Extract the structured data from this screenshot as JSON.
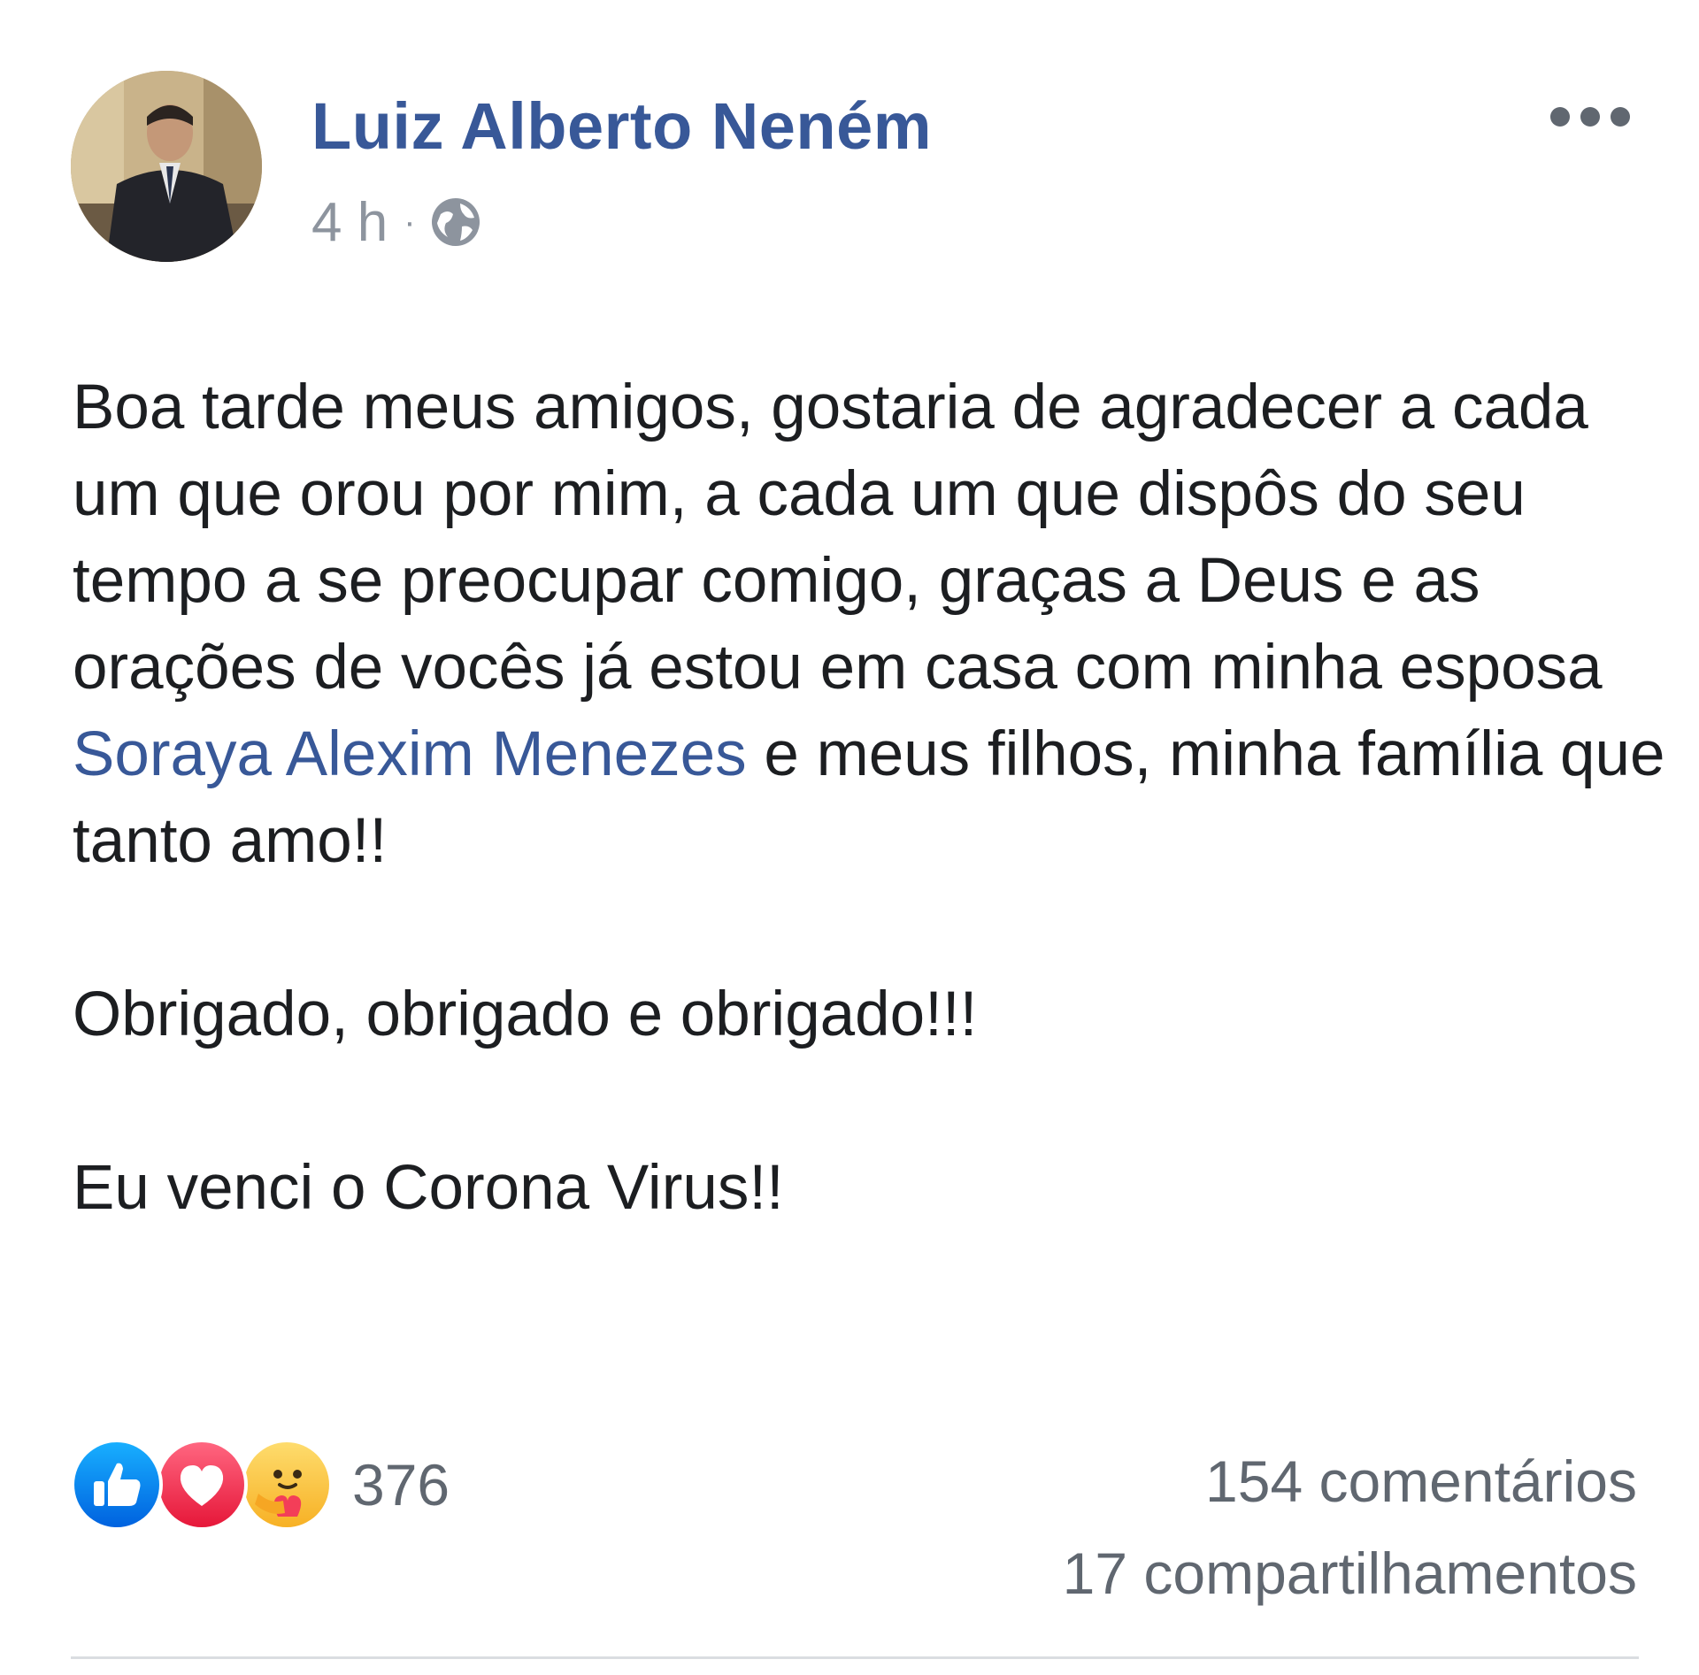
{
  "post": {
    "author": "Luiz Alberto Neném",
    "time": "4 h",
    "separator": "·",
    "privacy_icon": "globe-icon",
    "menu_icon": "more-options-icon",
    "paragraphs": [
      {
        "before": "Boa tarde meus amigos, gostaria de agradecer a cada um que orou por mim, a cada um que dispôs do seu tempo a se preocupar comigo, graças a Deus e as orações de vocês já estou em casa com minha esposa ",
        "mention": "Soraya Alexim Menezes",
        "after": " e meus filhos, minha família que tanto amo!!"
      },
      {
        "text": "Obrigado, obrigado e obrigado!!!"
      },
      {
        "text": "Eu venci o Corona Virus!!"
      }
    ]
  },
  "footer": {
    "reaction_icons": [
      "like-icon",
      "love-icon",
      "care-icon"
    ],
    "reaction_count": "376",
    "comments": "154 comentários",
    "shares": "17 compartilhamentos"
  },
  "colors": {
    "link": "#385898",
    "meta": "#8d949e",
    "text": "#1c1e21",
    "like": "#1877f2",
    "love": "#f33e58",
    "care": "#f7b125"
  }
}
